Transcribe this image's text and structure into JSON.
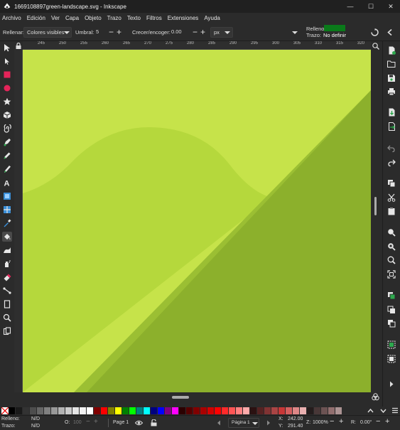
{
  "window": {
    "title": "1669108897green-landscape.svg - Inkscape",
    "minimize": "—",
    "maximize": "☐",
    "close": "✕"
  },
  "menu": [
    "Archivo",
    "Edición",
    "Ver",
    "Capa",
    "Objeto",
    "Trazo",
    "Texto",
    "Filtros",
    "Extensiones",
    "Ayuda"
  ],
  "tool_controls": {
    "fill_label": "Rellenar:",
    "fill_mode": "Colores visibles",
    "threshold_label": "Umbral:",
    "threshold_value": "5",
    "grow_label": "Crecer/encoger:",
    "grow_value": "0.00",
    "unit": "px",
    "fill_indicator_label": "Relleno",
    "stroke_indicator_label": "Trazo:",
    "stroke_indicator_value": "No definir",
    "fill_indicator_color": "#0a7a1a"
  },
  "ruler": {
    "ticks": [
      "245",
      "250",
      "255",
      "260",
      "265",
      "270",
      "275",
      "280",
      "285",
      "290",
      "295",
      "300",
      "305",
      "310",
      "315",
      "320"
    ]
  },
  "canvas": {
    "colors": {
      "sky": "#c6e34a",
      "hill": "#b5d83c",
      "foreground": "#8cb02c",
      "foreground_stripe": "#9bbf33"
    }
  },
  "palette_colors": [
    "#000000",
    "#1a1a1a",
    "#333333",
    "#4d4d4d",
    "#666666",
    "#808080",
    "#999999",
    "#b3b3b3",
    "#cccccc",
    "#e6e6e6",
    "#f2f2f2",
    "#ffffff",
    "#800000",
    "#ff0000",
    "#808000",
    "#ffff00",
    "#008000",
    "#00ff00",
    "#008080",
    "#00ffff",
    "#000080",
    "#0000ff",
    "#800080",
    "#ff00ff",
    "#2b0000",
    "#550000",
    "#800000",
    "#aa0000",
    "#d40000",
    "#ff0000",
    "#ff2a2a",
    "#ff5555",
    "#ff8080",
    "#ffaaaa",
    "#2b1111",
    "#552222",
    "#803333",
    "#aa4444",
    "#c83737",
    "#d35f5f",
    "#de8787",
    "#e9afaf",
    "#241c1c",
    "#483737",
    "#6c5353",
    "#916f6f",
    "#ac9393"
  ],
  "status": {
    "fill_label": "Relleno:",
    "fill_value": "N/D",
    "stroke_label": "Trazo:",
    "stroke_value": "N/D",
    "opacity_label": "O:",
    "opacity_value": "100",
    "page_label": "Page 1",
    "page_combo": "Página 1",
    "x_label": "X:",
    "x_value": "242.00",
    "y_label": "Y:",
    "y_value": "291.40",
    "zoom_label": "Z:",
    "zoom_value": "1000%",
    "rotation_label": "R:",
    "rotation_value": "0.00°"
  }
}
